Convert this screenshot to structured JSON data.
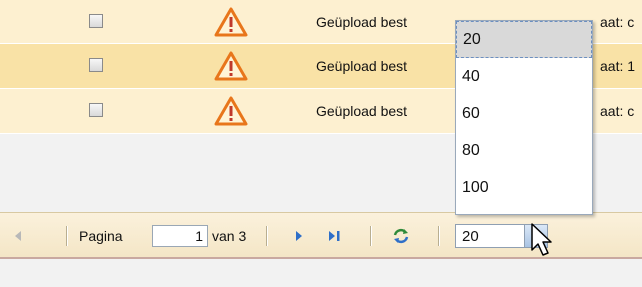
{
  "rows": [
    {
      "text": "Geüpload best",
      "text_tail": "aat: c"
    },
    {
      "text": "Geüpload best",
      "text_tail": "aat: 1"
    },
    {
      "text": "Geüpload best",
      "text_tail": "aat: c"
    }
  ],
  "pager": {
    "page_label": "Pagina",
    "page_value": "1",
    "of_label": "van 3",
    "page_size": "20"
  },
  "dropdown": {
    "options": [
      "20",
      "40",
      "60",
      "80",
      "100"
    ],
    "selected": "20"
  },
  "colors": {
    "row_odd": "#fdf0d0",
    "row_even": "#f9e2a6",
    "warning": "#e8761b",
    "nav_blue": "#2f6fc8"
  },
  "icons": {
    "row_icon": "warning-icon",
    "first": "arrow-left-icon",
    "next": "arrow-right-icon",
    "last": "arrow-last-icon",
    "refresh": "refresh-icon",
    "trigger": "chevron-down-icon",
    "cursor": "mouse-cursor-icon"
  }
}
